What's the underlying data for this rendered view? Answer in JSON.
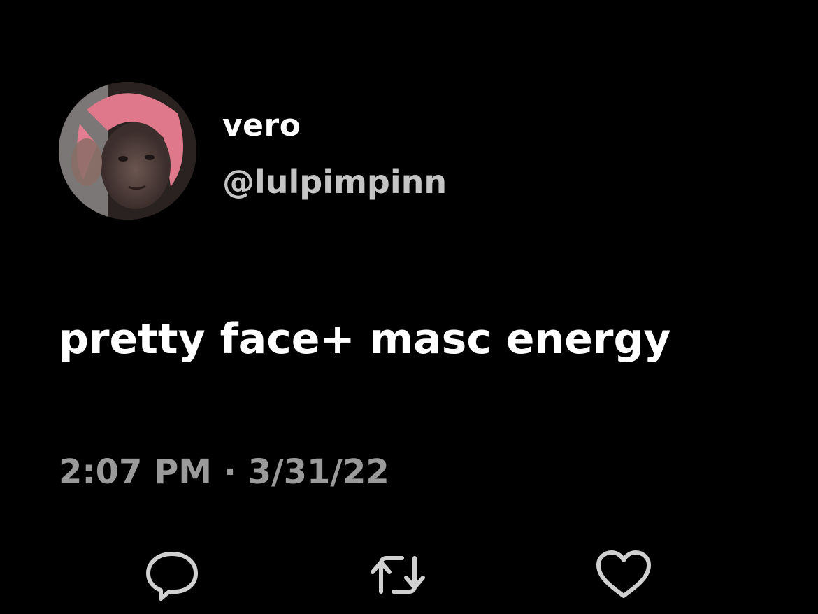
{
  "author": {
    "display_name": "vero",
    "handle": "@lulpimpinn",
    "avatar_icon": "profile-photo"
  },
  "tweet": {
    "text": "pretty face+ masc energy",
    "timestamp": "2:07 PM · 3/31/22"
  },
  "actions": [
    {
      "icon": "reply-icon"
    },
    {
      "icon": "retweet-icon"
    },
    {
      "icon": "like-icon"
    }
  ],
  "colors": {
    "background": "#000000",
    "primary_text": "#ffffff",
    "secondary_text": "#c4c4c4",
    "muted_text": "#9a9a9a",
    "icon": "#d0d0d0"
  }
}
